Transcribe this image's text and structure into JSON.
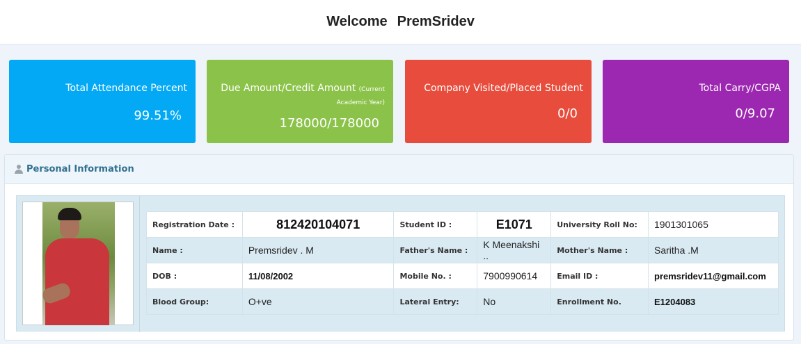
{
  "header": {
    "welcome": "Welcome",
    "user_name": "PremSridev"
  },
  "cards": {
    "attendance": {
      "label": "Total Attendance Percent",
      "value": "99.51%",
      "color": "#03a9f4"
    },
    "due": {
      "label": "Due Amount/Credit Amount",
      "note": "(Current Academic Year)",
      "value": "178000/178000",
      "color": "#8bc34a"
    },
    "company": {
      "label": "Company Visited/Placed Student",
      "value": "0/0",
      "color": "#e74c3c"
    },
    "carry": {
      "label": "Total Carry/CGPA",
      "value": "0/9.07",
      "color": "#9c27b0"
    }
  },
  "panel": {
    "title": "Personal Information",
    "icon": "user-icon"
  },
  "info": {
    "registration_date": {
      "label": "Registration Date :",
      "value": "812420104071"
    },
    "student_id": {
      "label": "Student ID :",
      "value": "E1071"
    },
    "university_roll": {
      "label": "University Roll No:",
      "value": "1901301065"
    },
    "name": {
      "label": "Name :",
      "value": "Premsridev . M"
    },
    "father": {
      "label": "Father's Name :",
      "value": "K Meenakshi .."
    },
    "mother": {
      "label": "Mother's Name :",
      "value": "Saritha .M"
    },
    "dob": {
      "label": "DOB :",
      "value": "11/08/2002"
    },
    "mobile": {
      "label": "Mobile No. :",
      "value": "7900990614"
    },
    "email": {
      "label": "Email ID :",
      "value": "premsridev11@gmail.com"
    },
    "blood_group": {
      "label": "Blood Group:",
      "value": "O+ve"
    },
    "lateral_entry": {
      "label": "Lateral Entry:",
      "value": "No"
    },
    "enrollment": {
      "label": "Enrollment No.",
      "value": "E1204083"
    }
  }
}
